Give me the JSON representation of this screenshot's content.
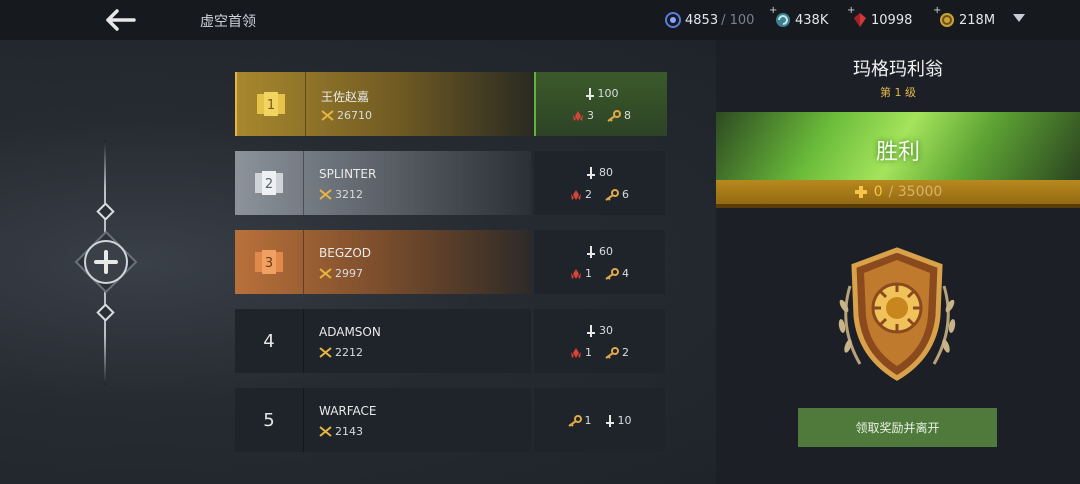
{
  "header": {
    "title": "虚空首领",
    "resources": [
      {
        "icon": "energy-icon",
        "value": "4853",
        "max": "/ 100"
      },
      {
        "icon": "swirl-icon",
        "value": "438K"
      },
      {
        "icon": "red-gem-icon",
        "value": "10998"
      },
      {
        "icon": "gold-coin-icon",
        "value": "218M"
      }
    ]
  },
  "leaderboard": [
    {
      "rank": "1",
      "name": "王佐赵嘉",
      "power": "26710",
      "attack": "100",
      "red": "3",
      "key": "8"
    },
    {
      "rank": "2",
      "name": "SPLINTER",
      "power": "3212",
      "attack": "80",
      "red": "2",
      "key": "6"
    },
    {
      "rank": "3",
      "name": "BEGZOD",
      "power": "2997",
      "attack": "60",
      "red": "1",
      "key": "4"
    },
    {
      "rank": "4",
      "name": "ADAMSON",
      "power": "2212",
      "attack": "30",
      "red": "1",
      "key": "2"
    },
    {
      "rank": "5",
      "name": "WARFACE",
      "power": "2143",
      "key": "1",
      "attack": "10"
    }
  ],
  "boss": {
    "name": "玛格玛利翁",
    "level": "第 1 级",
    "result": "胜利",
    "progress_current": "0",
    "progress_total": "/ 35000",
    "claim_label": "领取奖励并离开"
  },
  "colors": {
    "gold": "#e8b640",
    "green": "#63b23a",
    "bronze": "#b9703a",
    "silver": "#8d939b"
  }
}
